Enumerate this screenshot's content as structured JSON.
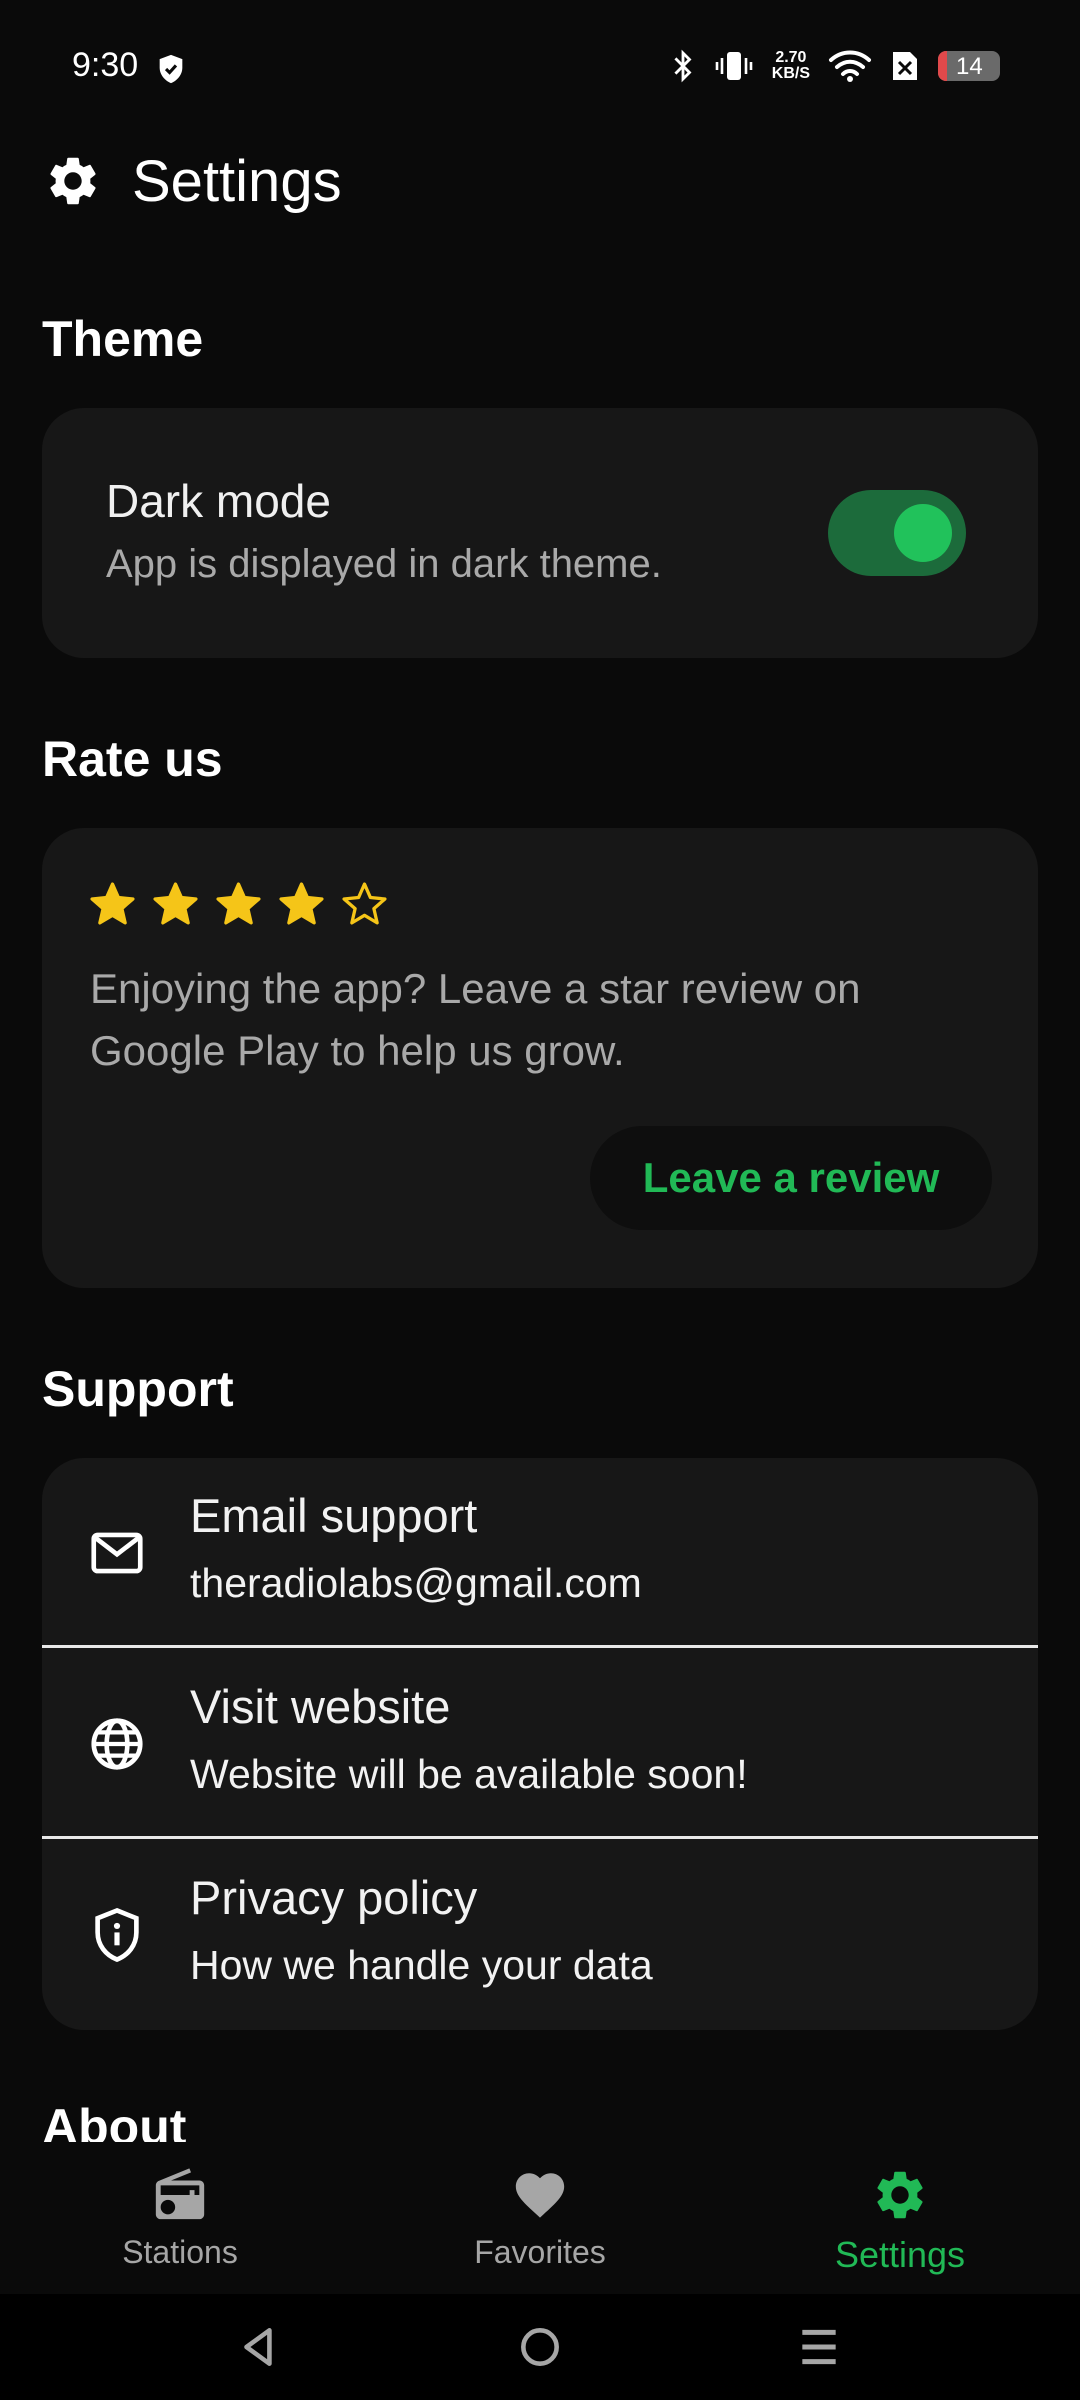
{
  "status_bar": {
    "time": "9:30",
    "net_speed_value": "2.70",
    "net_speed_unit": "KB/S",
    "battery": "14",
    "battery_level_percent": 14
  },
  "header": {
    "title": "Settings",
    "icon": "gear-icon"
  },
  "theme": {
    "section_title": "Theme",
    "dark_mode_title": "Dark mode",
    "dark_mode_subtitle": "App is displayed in dark theme.",
    "dark_mode_enabled": true
  },
  "rate": {
    "section_title": "Rate us",
    "stars_filled": 4,
    "stars_total": 5,
    "text": "Enjoying the app? Leave a star review on Google Play to help us grow.",
    "button_label": "Leave a review"
  },
  "support": {
    "section_title": "Support",
    "items": [
      {
        "icon": "mail-icon",
        "title": "Email support",
        "subtitle": "theradiolabs@gmail.com"
      },
      {
        "icon": "globe-icon",
        "title": "Visit website",
        "subtitle": "Website will be available soon!"
      },
      {
        "icon": "shield-info-icon",
        "title": "Privacy policy",
        "subtitle": "How we handle your data"
      }
    ]
  },
  "about": {
    "section_title": "About"
  },
  "bottom_nav": {
    "items": [
      {
        "icon": "radio-icon",
        "label": "Stations",
        "active": false
      },
      {
        "icon": "heart-icon",
        "label": "Favorites",
        "active": false
      },
      {
        "icon": "gear-icon",
        "label": "Settings",
        "active": true
      }
    ]
  },
  "colors": {
    "background": "#0a0a0a",
    "card": "#171717",
    "accent": "#21b956",
    "star": "#f5c518",
    "muted_text": "#a9a9a9"
  }
}
